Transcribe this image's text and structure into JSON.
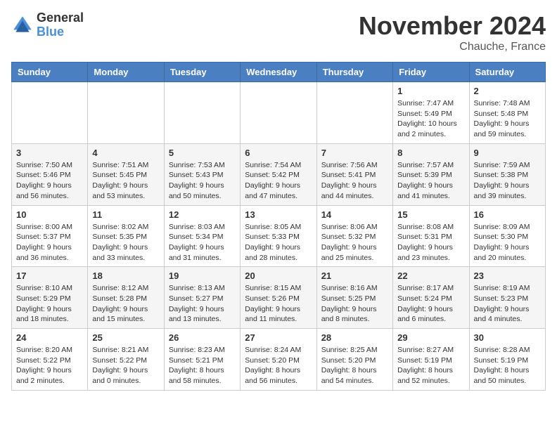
{
  "logo": {
    "line1": "General",
    "line2": "Blue"
  },
  "title": "November 2024",
  "location": "Chauche, France",
  "days_of_week": [
    "Sunday",
    "Monday",
    "Tuesday",
    "Wednesday",
    "Thursday",
    "Friday",
    "Saturday"
  ],
  "weeks": [
    [
      {
        "day": "",
        "info": ""
      },
      {
        "day": "",
        "info": ""
      },
      {
        "day": "",
        "info": ""
      },
      {
        "day": "",
        "info": ""
      },
      {
        "day": "",
        "info": ""
      },
      {
        "day": "1",
        "info": "Sunrise: 7:47 AM\nSunset: 5:49 PM\nDaylight: 10 hours and 2 minutes."
      },
      {
        "day": "2",
        "info": "Sunrise: 7:48 AM\nSunset: 5:48 PM\nDaylight: 9 hours and 59 minutes."
      }
    ],
    [
      {
        "day": "3",
        "info": "Sunrise: 7:50 AM\nSunset: 5:46 PM\nDaylight: 9 hours and 56 minutes."
      },
      {
        "day": "4",
        "info": "Sunrise: 7:51 AM\nSunset: 5:45 PM\nDaylight: 9 hours and 53 minutes."
      },
      {
        "day": "5",
        "info": "Sunrise: 7:53 AM\nSunset: 5:43 PM\nDaylight: 9 hours and 50 minutes."
      },
      {
        "day": "6",
        "info": "Sunrise: 7:54 AM\nSunset: 5:42 PM\nDaylight: 9 hours and 47 minutes."
      },
      {
        "day": "7",
        "info": "Sunrise: 7:56 AM\nSunset: 5:41 PM\nDaylight: 9 hours and 44 minutes."
      },
      {
        "day": "8",
        "info": "Sunrise: 7:57 AM\nSunset: 5:39 PM\nDaylight: 9 hours and 41 minutes."
      },
      {
        "day": "9",
        "info": "Sunrise: 7:59 AM\nSunset: 5:38 PM\nDaylight: 9 hours and 39 minutes."
      }
    ],
    [
      {
        "day": "10",
        "info": "Sunrise: 8:00 AM\nSunset: 5:37 PM\nDaylight: 9 hours and 36 minutes."
      },
      {
        "day": "11",
        "info": "Sunrise: 8:02 AM\nSunset: 5:35 PM\nDaylight: 9 hours and 33 minutes."
      },
      {
        "day": "12",
        "info": "Sunrise: 8:03 AM\nSunset: 5:34 PM\nDaylight: 9 hours and 31 minutes."
      },
      {
        "day": "13",
        "info": "Sunrise: 8:05 AM\nSunset: 5:33 PM\nDaylight: 9 hours and 28 minutes."
      },
      {
        "day": "14",
        "info": "Sunrise: 8:06 AM\nSunset: 5:32 PM\nDaylight: 9 hours and 25 minutes."
      },
      {
        "day": "15",
        "info": "Sunrise: 8:08 AM\nSunset: 5:31 PM\nDaylight: 9 hours and 23 minutes."
      },
      {
        "day": "16",
        "info": "Sunrise: 8:09 AM\nSunset: 5:30 PM\nDaylight: 9 hours and 20 minutes."
      }
    ],
    [
      {
        "day": "17",
        "info": "Sunrise: 8:10 AM\nSunset: 5:29 PM\nDaylight: 9 hours and 18 minutes."
      },
      {
        "day": "18",
        "info": "Sunrise: 8:12 AM\nSunset: 5:28 PM\nDaylight: 9 hours and 15 minutes."
      },
      {
        "day": "19",
        "info": "Sunrise: 8:13 AM\nSunset: 5:27 PM\nDaylight: 9 hours and 13 minutes."
      },
      {
        "day": "20",
        "info": "Sunrise: 8:15 AM\nSunset: 5:26 PM\nDaylight: 9 hours and 11 minutes."
      },
      {
        "day": "21",
        "info": "Sunrise: 8:16 AM\nSunset: 5:25 PM\nDaylight: 9 hours and 8 minutes."
      },
      {
        "day": "22",
        "info": "Sunrise: 8:17 AM\nSunset: 5:24 PM\nDaylight: 9 hours and 6 minutes."
      },
      {
        "day": "23",
        "info": "Sunrise: 8:19 AM\nSunset: 5:23 PM\nDaylight: 9 hours and 4 minutes."
      }
    ],
    [
      {
        "day": "24",
        "info": "Sunrise: 8:20 AM\nSunset: 5:22 PM\nDaylight: 9 hours and 2 minutes."
      },
      {
        "day": "25",
        "info": "Sunrise: 8:21 AM\nSunset: 5:22 PM\nDaylight: 9 hours and 0 minutes."
      },
      {
        "day": "26",
        "info": "Sunrise: 8:23 AM\nSunset: 5:21 PM\nDaylight: 8 hours and 58 minutes."
      },
      {
        "day": "27",
        "info": "Sunrise: 8:24 AM\nSunset: 5:20 PM\nDaylight: 8 hours and 56 minutes."
      },
      {
        "day": "28",
        "info": "Sunrise: 8:25 AM\nSunset: 5:20 PM\nDaylight: 8 hours and 54 minutes."
      },
      {
        "day": "29",
        "info": "Sunrise: 8:27 AM\nSunset: 5:19 PM\nDaylight: 8 hours and 52 minutes."
      },
      {
        "day": "30",
        "info": "Sunrise: 8:28 AM\nSunset: 5:19 PM\nDaylight: 8 hours and 50 minutes."
      }
    ]
  ]
}
